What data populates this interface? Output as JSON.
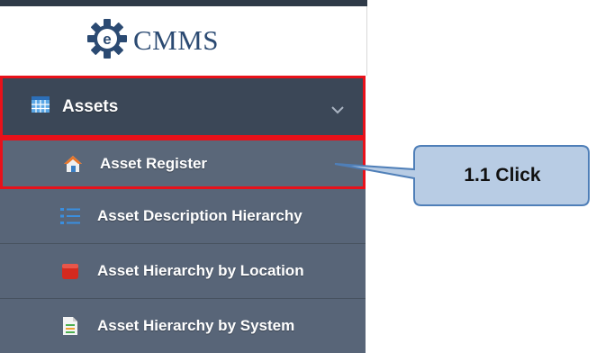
{
  "logo": {
    "text": "CMMS",
    "icon": "gear-e-icon"
  },
  "menu": {
    "section": {
      "label": "Assets",
      "icon": "grid-table-icon",
      "toggle_icon": "chevron-down-icon",
      "expanded": true
    },
    "items": [
      {
        "label": "Asset Register",
        "icon": "home-icon",
        "highlighted": true
      },
      {
        "label": "Asset Description Hierarchy",
        "icon": "list-icon"
      },
      {
        "label": "Asset Hierarchy by Location",
        "icon": "red-box-icon"
      },
      {
        "label": "Asset Hierarchy by System",
        "icon": "document-icon"
      }
    ]
  },
  "callout": {
    "text": "1.1 Click"
  },
  "colors": {
    "highlight_border": "#e8111a",
    "section_bg": "#3b4757",
    "item_bg": "#586578",
    "callout_fill": "#b8cce4",
    "callout_stroke": "#4f7fb8",
    "logo_text": "#2b4a72"
  }
}
